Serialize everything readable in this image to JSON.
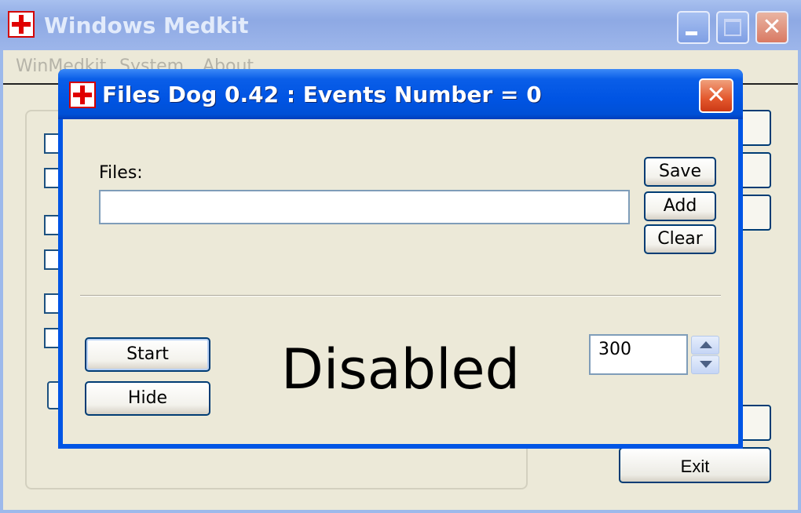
{
  "main_window": {
    "title": "Windows Medkit",
    "menu": [
      "WinMedkit",
      "System",
      "About"
    ],
    "exit_label": "Exit"
  },
  "dialog": {
    "title": "Files Dog 0.42 :  Events Number = 0",
    "files_label": "Files:",
    "files_value": "",
    "save_label": "Save",
    "add_label": "Add",
    "clear_label": "Clear",
    "start_label": "Start",
    "hide_label": "Hide",
    "status": "Disabled",
    "interval_value": "300"
  },
  "icons": {
    "app": "red-cross-icon",
    "close": "close-icon",
    "minimize": "minimize-icon",
    "maximize": "maximize-icon",
    "spin_up": "spin-up-icon",
    "spin_down": "spin-down-icon"
  },
  "colors": {
    "titlebar_active": "#0054e3",
    "titlebar_inactive": "#9db9eb",
    "close_button": "#e3572c",
    "window_face": "#ece9d8",
    "button_border": "#003c74"
  }
}
